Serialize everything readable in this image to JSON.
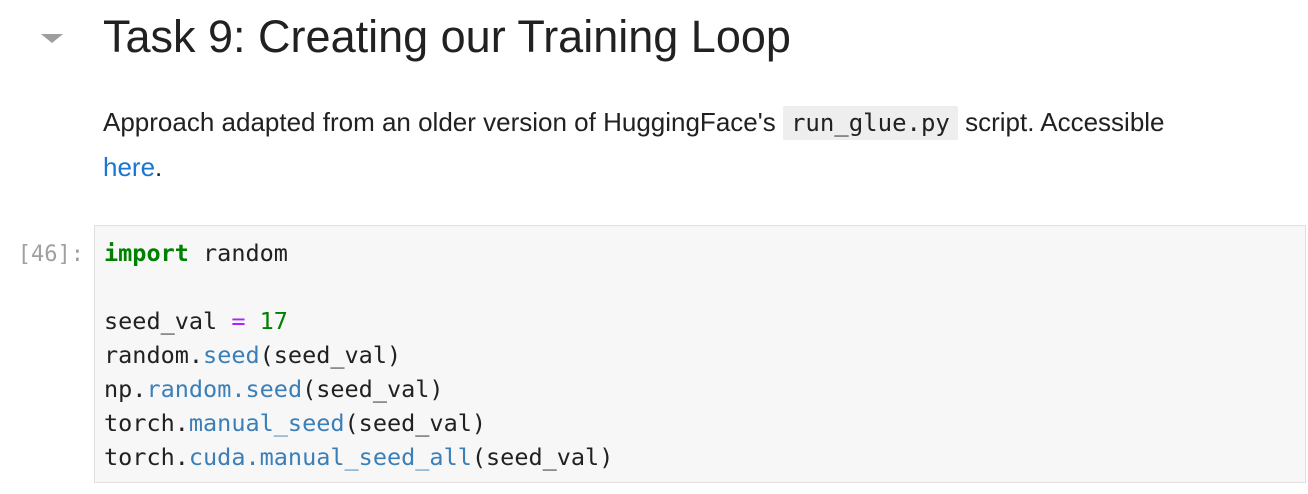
{
  "heading": {
    "text": "Task 9: Creating our Training Loop",
    "toggle_icon": "caret-down-icon"
  },
  "markdown": {
    "text_before": "Approach adapted from an older version of HuggingFace's ",
    "inline_code": "run_glue.py",
    "text_after": " script. Accessible ",
    "link_text": "here",
    "trailing": "."
  },
  "code_cell": {
    "prompt": "[46]:",
    "lines": [
      {
        "keyword": "import",
        "text": " random"
      },
      {
        "text": ""
      },
      {
        "name": "seed_val",
        "operator": "=",
        "number": "17"
      },
      {
        "object": "random.",
        "method": "seed",
        "args": "(seed_val)"
      },
      {
        "object": "np.",
        "attr": "random.",
        "method": "seed",
        "args": "(seed_val)"
      },
      {
        "object": "torch.",
        "method": "manual_seed",
        "args": "(seed_val)"
      },
      {
        "object": "torch.",
        "attr": "cuda.",
        "method": "manual_seed_all",
        "args": "(seed_val)"
      }
    ]
  },
  "colors": {
    "keyword": "#008000",
    "number": "#008000",
    "operator": "#aa22ff",
    "attribute": "#3a7fb8",
    "link": "#1976d2",
    "prompt": "#a0a0a0",
    "editor_background": "#f7f7f7"
  }
}
